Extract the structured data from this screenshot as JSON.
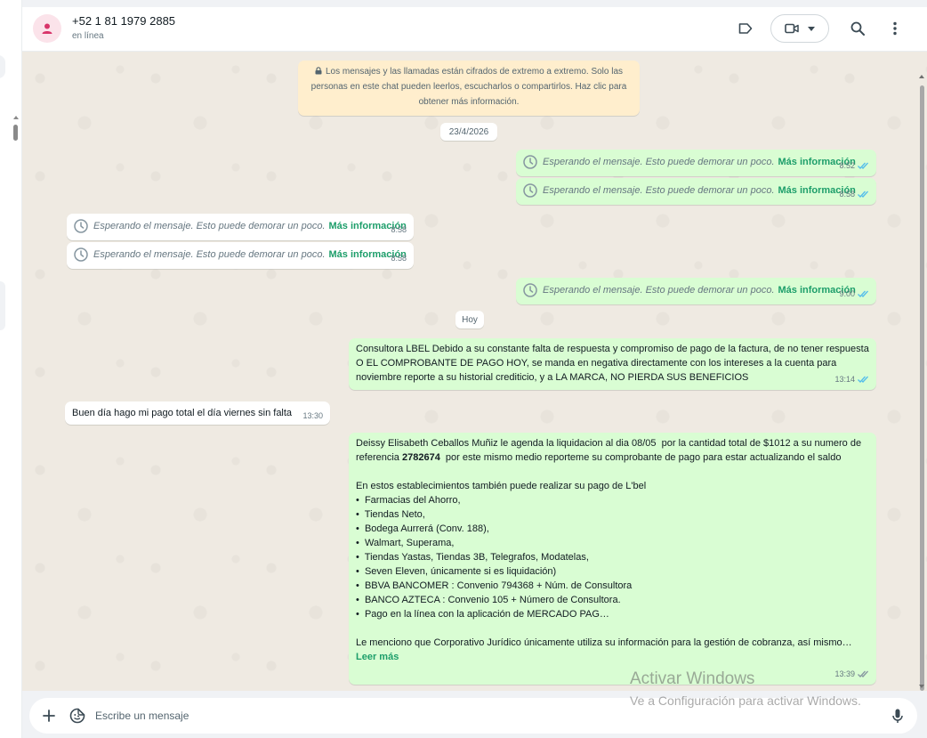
{
  "contact": {
    "name": "+52 1 81 1979 2885",
    "status": "en línea"
  },
  "encryption_notice": "Los mensajes y las llamadas están cifrados de extremo a extremo. Solo las personas en este chat pueden leerlos, escucharlos o compartirlos. Haz clic para obtener más información.",
  "dates": {
    "first": "23/4/2026",
    "second": "Hoy"
  },
  "waiting": {
    "text": "Esperando el mensaje. Esto puede demorar un poco.",
    "more": "Más información"
  },
  "messages": {
    "w1_time": "8:52",
    "w2_time": "8:58",
    "w3_time": "8:58",
    "w4_time": "8:58",
    "w5_time": "9:00",
    "m1_text": "Consultora LBEL Debido a su constante falta de respuesta y compromiso de pago de la factura, de no tener respuesta O EL COMPROBANTE DE PAGO HOY, se manda en negativa directamente con los intereses a la cuenta para noviembre reporte a su historial crediticio, y a LA MARCA, NO PIERDA SUS BENEFICIOS",
    "m1_time": "13:14",
    "m2_text": "Buen día hago mi pago total el día viernes sin falta",
    "m2_time": "13:30",
    "m3_intro_a": "Deissy Elisabeth Ceballos Muñiz le agenda la liquidacion al dia 08/05  por la cantidad total de $1012 a su numero de referencia ",
    "m3_ref": "2782674",
    "m3_intro_b": "  por este mismo medio reporteme su comprobante de pago para estar actualizando el saldo",
    "m3_places_title": "En estos establecimientos también puede realizar su pago de L'bel",
    "m3_places": [
      "•  Farmacias del Ahorro,",
      "•  Tiendas Neto,",
      "•  Bodega Aurrerá (Conv. 188),",
      "•  Walmart, Superama,",
      "•  Tiendas Yastas, Tiendas 3B, Telegrafos, Modatelas,",
      "•  Seven Eleven, únicamente si es liquidación)",
      "•  BBVA BANCOMER : Convenio 794368 + Núm. de Consultora",
      "•  BANCO AZTECA : Convenio 105 + Número de Consultora.",
      "•  Pago en la línea con la aplicación de MERCADO PAG…"
    ],
    "m3_closing": "Le menciono que Corporativo Jurídico únicamente utiliza su información para la gestión de cobranza, así mismo…",
    "m3_read_more": "Leer más",
    "m3_time": "13:39"
  },
  "watermark": {
    "title": "Activar Windows",
    "subtitle": "Ve a Configuración para activar Windows."
  },
  "composer": {
    "placeholder": "Escribe un mensaje"
  },
  "colors": {
    "outgoing": "#d9fdd3",
    "incoming": "#ffffff",
    "accent": "#1d9e6a",
    "tick_read": "#53bdeb"
  },
  "icons": [
    "contact-avatar-icon",
    "label-icon",
    "video-call-icon",
    "search-icon",
    "menu-icon",
    "lock-icon",
    "clock-icon",
    "read-ticks-icon",
    "plus-icon",
    "sticker-icon",
    "mic-icon"
  ]
}
